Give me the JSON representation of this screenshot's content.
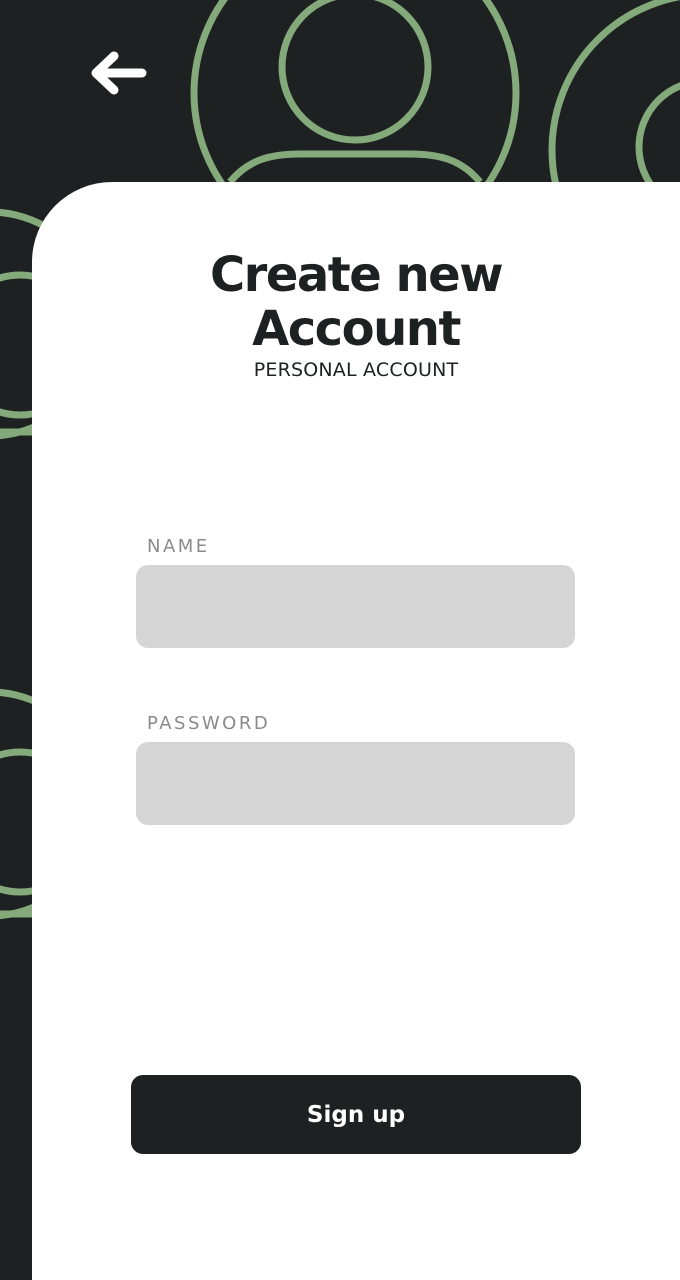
{
  "header": {
    "back_icon": "arrow-left-icon"
  },
  "form": {
    "title_line1": "Create new",
    "title_line2": "Account",
    "subtitle": "PERSONAL ACCOUNT",
    "name_label": "NAME",
    "name_value": "",
    "password_label": "PASSWORD",
    "password_value": "",
    "submit_label": "Sign up"
  },
  "colors": {
    "background": "#1e2121",
    "accent": "#84a97a",
    "card": "#ffffff",
    "input_fill": "#d5d5d5",
    "button": "#1e2121"
  }
}
